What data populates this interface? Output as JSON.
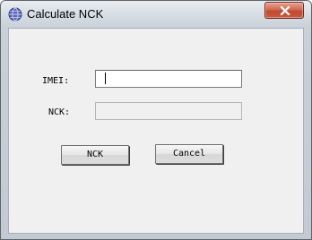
{
  "window": {
    "title": "Calculate NCK",
    "icon": "globe-app-icon",
    "close_icon": "close-icon"
  },
  "form": {
    "imei_label": "IMEI:",
    "imei_value": "",
    "nck_label": "NCK:",
    "nck_value": ""
  },
  "buttons": {
    "nck_label": "NCK",
    "cancel_label": "Cancel"
  },
  "colors": {
    "close_button": "#c65a3e",
    "client_background": "#f0f0f0"
  }
}
